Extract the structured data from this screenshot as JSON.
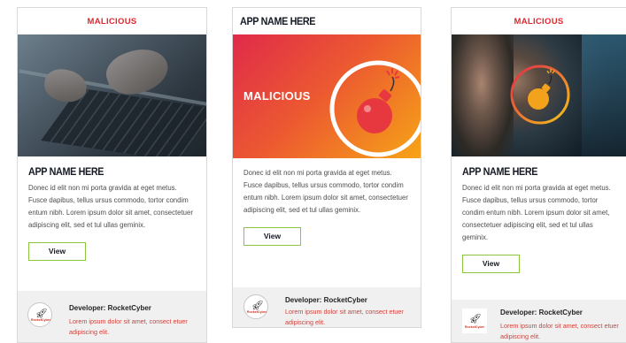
{
  "cards": [
    {
      "tag": "MALICIOUS",
      "title": "APP NAME HERE",
      "description": "Donec id elit non mi porta gravida at eget metus. Fusce dapibus, tellus ursus commodo, tortor condim entum nibh. Lorem ipsum dolor sit amet, consectetuer adipiscing elit, sed  et tul ullas geminix.",
      "button_label": "View",
      "developer": "Developer: RocketCyber",
      "developer_desc": "Lorem ipsum dolor sit amet, consect etuer adipiscing elit.",
      "logo_text": "RocketCyber"
    },
    {
      "title": "APP NAME HERE",
      "hero_label": "MALICIOUS",
      "description": "Donec id elit non mi porta gravida at eget metus. Fusce dapibus, tellus ursus commodo, tortor condim entum nibh. Lorem ipsum dolor sit amet, consectetuer adipiscing elit, sed  et tul ullas geminix.",
      "button_label": "View",
      "developer": "Developer: RocketCyber",
      "developer_desc": "Lorem ipsum dolor sit amet, consect etuer adipiscing elit.",
      "logo_text": "RocketCyber"
    },
    {
      "tag": "MALICIOUS",
      "title": "APP NAME HERE",
      "description": "Donec id elit non mi porta gravida at eget metus. Fusce dapibus, tellus ursus commodo, tortor condim entum nibh. Lorem ipsum dolor sit amet, consectetuer adipiscing elit, sed  et tul ullas geminix.",
      "button_label": "View",
      "developer": "Developer: RocketCyber",
      "developer_desc": "Lorem ipsum dolor sit amet, consect etuer adipiscing elit.",
      "logo_text": "RocketCyber"
    }
  ],
  "colors": {
    "tag_red": "#e2262e",
    "button_border": "#8cc63f",
    "gradient_start": "#e02a4a",
    "gradient_end": "#f6a417"
  },
  "icons": {
    "bomb": "bomb-icon",
    "logo": "rocket-icon"
  }
}
